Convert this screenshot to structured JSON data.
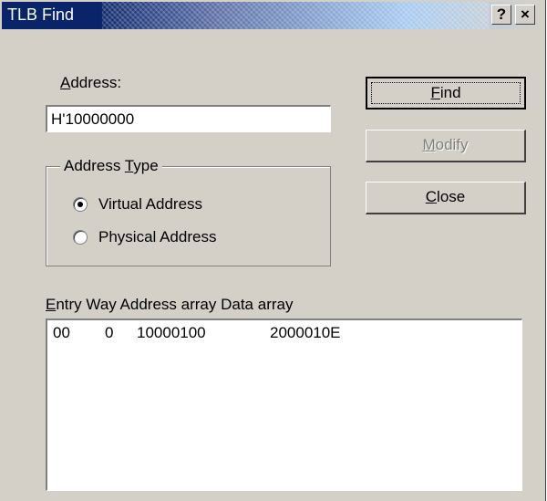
{
  "window": {
    "title": "TLB Find"
  },
  "titlebar": {
    "help": "?",
    "close": "×"
  },
  "address": {
    "label_access": "A",
    "label_rest": "ddress:",
    "value": "H'10000000"
  },
  "address_type": {
    "legend_pre": "Address ",
    "legend_access": "T",
    "legend_rest": "ype",
    "options": [
      {
        "label": "Virtual Address",
        "selected": true
      },
      {
        "label": "Physical Address",
        "selected": false
      }
    ]
  },
  "buttons": {
    "find_access": "F",
    "find_rest": "ind",
    "modify_access": "M",
    "modify_rest": "odify",
    "close_access": "C",
    "close_rest": "lose"
  },
  "results": {
    "header_access": "E",
    "header_rest": "ntry Way Address array Data array",
    "rows": [
      {
        "entry": "00",
        "way": "0",
        "address_array": "10000100",
        "data_array": "2000010E"
      }
    ]
  }
}
